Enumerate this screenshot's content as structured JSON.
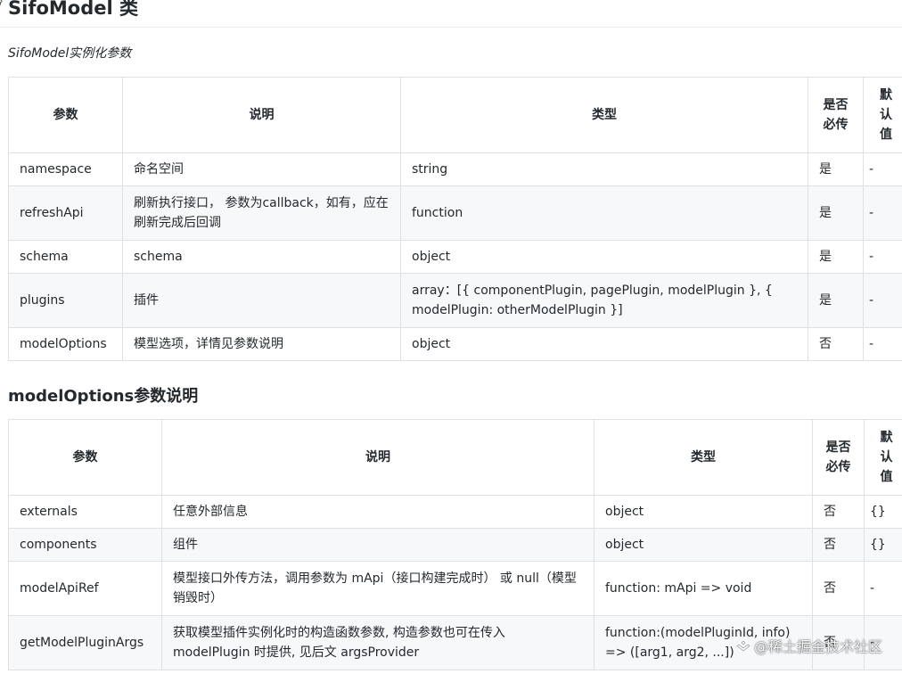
{
  "heading": {
    "anchor_glyph": "ˀ",
    "title": "SifoModel 类"
  },
  "subtitle": "SifoModel实例化参数",
  "table1": {
    "headers": {
      "param": "参数",
      "desc": "说明",
      "type": "类型",
      "required": "是否必传",
      "default": "默认值"
    },
    "rows": [
      {
        "param": "namespace",
        "desc": "命名空间",
        "type": "string",
        "required": "是",
        "default": "-"
      },
      {
        "param": "refreshApi",
        "desc": "刷新执行接口， 参数为callback，如有，应在刷新完成后回调",
        "type": "function",
        "required": "是",
        "default": "-"
      },
      {
        "param": "schema",
        "desc": "schema",
        "type": "object",
        "required": "是",
        "default": "-"
      },
      {
        "param": "plugins",
        "desc": "插件",
        "type": "array：[{ componentPlugin, pagePlugin, modelPlugin }, { modelPlugin: otherModelPlugin }]",
        "required": "是",
        "default": "-"
      },
      {
        "param": "modelOptions",
        "desc": "模型选项，详情见参数说明",
        "type": "object",
        "required": "否",
        "default": "-"
      }
    ]
  },
  "section2_title": "modelOptions参数说明",
  "table2": {
    "headers": {
      "param": "参数",
      "desc": "说明",
      "type": "类型",
      "required": "是否必传",
      "default": "默认值"
    },
    "rows": [
      {
        "param": "externals",
        "desc": "任意外部信息",
        "type": "object",
        "required": "否",
        "default": "{}"
      },
      {
        "param": "components",
        "desc": "组件",
        "type": "object",
        "required": "否",
        "default": "{}"
      },
      {
        "param": "modelApiRef",
        "desc": "模型接口外传方法，调用参数为 mApi（接口构建完成时） 或 null（模型销毁时）",
        "type": "function: mApi => void",
        "required": "否",
        "default": "-"
      },
      {
        "param": "getModelPluginArgs",
        "desc": "获取模型插件实例化时的构造函数参数, 构造参数也可在传入 modelPlugin 时提供, 见后文 argsProvider",
        "type": "function:(modelPluginId, info) => ([arg1, arg2, ...])",
        "required": "否",
        "default": "-"
      }
    ]
  },
  "watermark": "@稀土掘金技术社区"
}
